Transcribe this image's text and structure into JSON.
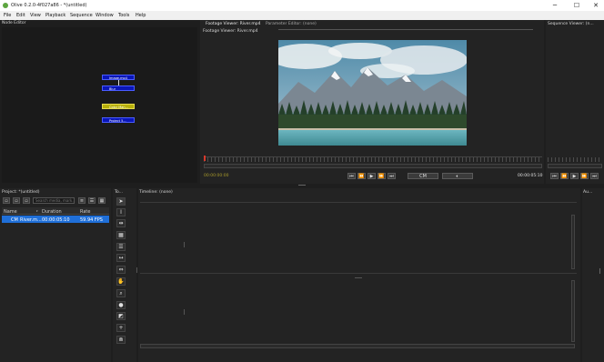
{
  "window": {
    "title": "Olive 0.2.0-4f027a86 - *(untitled)",
    "minimize_glyph": "─",
    "maximize_glyph": "☐",
    "close_glyph": "✕"
  },
  "menu": [
    "File",
    "Edit",
    "View",
    "Playback",
    "Sequence",
    "Window",
    "Tools",
    "Help"
  ],
  "node_editor": {
    "title": "Node Editor",
    "nodes": [
      "Image.mp4",
      "Blur",
      "Color Man...",
      "Project 5..."
    ],
    "node_sub": [
      "Media",
      "Process",
      "",
      ""
    ]
  },
  "viewer": {
    "tabs": [
      "Footage Viewer: River.mp4",
      "Parameter Editor: (none)"
    ],
    "subtitle": "Footage Viewer: River.mp4",
    "timecode_left": "00:00:00:00",
    "timecode_right": "00:00:05:10",
    "cm_label": "CM"
  },
  "sequence_viewer": {
    "title": "Sequence Viewer: (n..."
  },
  "project": {
    "title": "Project: *(untitled)",
    "search_placeholder": "Search media, mark...",
    "columns": [
      "Name",
      "Duration",
      "Rate"
    ],
    "rows": [
      {
        "icon": "CM",
        "name": "River.m...",
        "duration": "00:00:05:10",
        "rate": "59.94 FPS"
      }
    ]
  },
  "tools": {
    "title": "To..."
  },
  "timeline": {
    "title": "Timeline: (none)"
  },
  "audio_monitor": {
    "title": "Au..."
  },
  "colors": {
    "accent": "#1f6fd8",
    "node_blue": "#0a16b8",
    "node_yellow": "#b8b00c",
    "timecode": "#a89a2a",
    "playhead": "#d8392b"
  }
}
